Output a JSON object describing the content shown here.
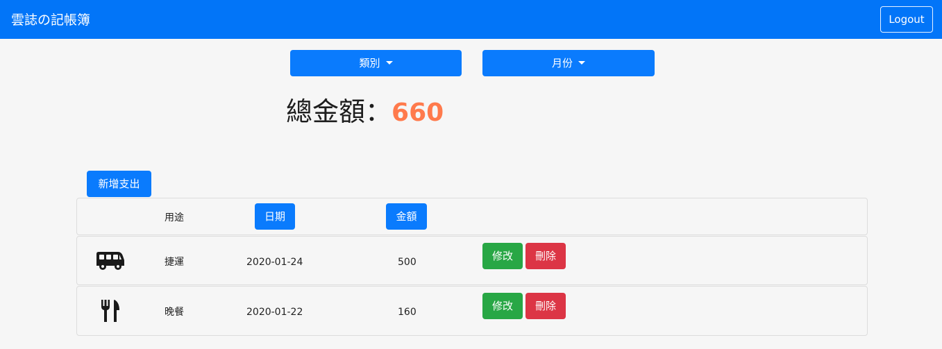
{
  "navbar": {
    "brand": "雲誌の記帳簿",
    "logout_label": "Logout"
  },
  "filters": {
    "category_label": "類別",
    "month_label": "月份"
  },
  "total": {
    "label": "總金額：",
    "value": "660",
    "value_color": "#ff7a4c"
  },
  "add_button_label": "新增支出",
  "table": {
    "headers": {
      "purpose": "用途",
      "date": "日期",
      "amount": "金額"
    },
    "rows": [
      {
        "icon": "bus-icon",
        "purpose": "捷運",
        "date": "2020-01-24",
        "amount": "500",
        "edit_label": "修改",
        "delete_label": "刪除"
      },
      {
        "icon": "utensils-icon",
        "purpose": "晚餐",
        "date": "2020-01-22",
        "amount": "160",
        "edit_label": "修改",
        "delete_label": "刪除"
      }
    ]
  },
  "colors": {
    "primary": "#0a7bfd",
    "navbar": "#0275f8",
    "success": "#28a745",
    "danger": "#dc3545"
  }
}
